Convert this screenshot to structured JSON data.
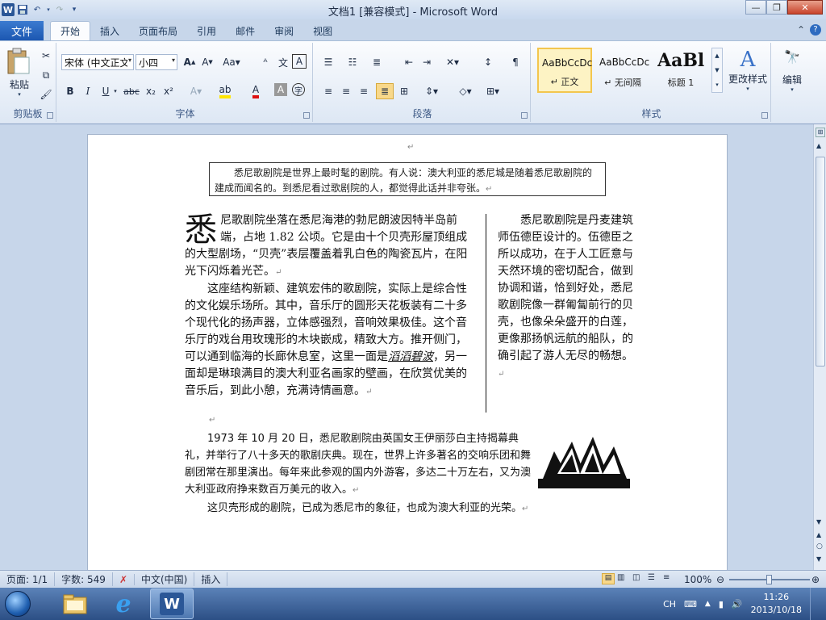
{
  "window": {
    "title": "文档1 [兼容模式] - Microsoft Word"
  },
  "tabs": {
    "file": "文件",
    "items": [
      "开始",
      "插入",
      "页面布局",
      "引用",
      "邮件",
      "审阅",
      "视图"
    ],
    "active": "开始"
  },
  "ribbon": {
    "clipboard": {
      "label": "剪贴板",
      "paste": "粘贴"
    },
    "font": {
      "label": "字体",
      "font_name": "宋体 (中文正文",
      "font_size": "小四"
    },
    "paragraph": {
      "label": "段落"
    },
    "styles": {
      "label": "样式",
      "items": [
        {
          "preview": "AaBbCcDc",
          "name": "↵ 正文"
        },
        {
          "preview": "AaBbCcDc",
          "name": "↵ 无间隔"
        },
        {
          "preview": "AaBl",
          "name": "标题 1"
        }
      ],
      "change_styles": "更改样式"
    },
    "editing": {
      "label": "编辑"
    }
  },
  "document": {
    "box_text": "悉尼歌剧院是世界上最时髦的剧院。有人说：澳大利亚的悉尼城是随着悉尼歌剧院的建成而闻名的。到悉尼看过歌剧院的人，都觉得此话并非夸张。",
    "dropcap": "悉",
    "col_left_p1": "尼歌剧院坐落在悉尼海港的勃尼朗波因特半岛前端，占地 1.82 公顷。它是由十个贝壳形屋顶组成的大型剧场，“贝壳”表层覆盖着乳白色的陶瓷瓦片，在阳光下闪烁着光芒。",
    "col_left_p2_a": "这座结构新颖、建筑宏伟的歌剧院，实际上是综合性的文化娱乐场所。其中，音乐厅的圆形天花板装有二十多个现代化的扬声器，立体感强烈，音响效果极佳。这个音乐厅的戏台用玫瑰形的木块嵌成，精致大方。推开侧门，可以通到临海的长廊休息室，这里一面是",
    "col_left_p2_em": "滔滔碧波",
    "col_left_p2_b": "，另一面却是琳琅满目的澳大利亚名画家的壁画，在欣赏优美的音乐后，到此小憩，充满诗情画意。",
    "col_right": "悉尼歌剧院是丹麦建筑师伍德臣设计的。伍德臣之所以成功，在于人工匠意与天然环境的密切配合，做到协调和谐，恰到好处，悉尼歌剧院像一群匍匐前行的贝壳，也像朵朵盛开的白莲，更像那扬帆远航的船队，的确引起了游人无尽的畅想。",
    "p3": "1973 年 10 月 20 日，悉尼歌剧院由英国女王伊丽莎白主持揭幕典礼，并举行了八十多天的歌剧庆典。现在，世界上许多著名的交响乐团和舞剧团常在那里演出。每年来此参观的国内外游客，多达二十万左右，又为澳大利亚政府挣来数百万美元的收入。",
    "p4": "这贝壳形成的剧院，已成为悉尼市的象征，也成为澳大利亚的光荣。"
  },
  "status": {
    "page": "页面: 1/1",
    "words": "字数: 549",
    "lang": "中文(中国)",
    "mode": "插入",
    "zoom": "100%"
  },
  "tray": {
    "ime": "CH",
    "time": "11:26",
    "date": "2013/10/18"
  }
}
